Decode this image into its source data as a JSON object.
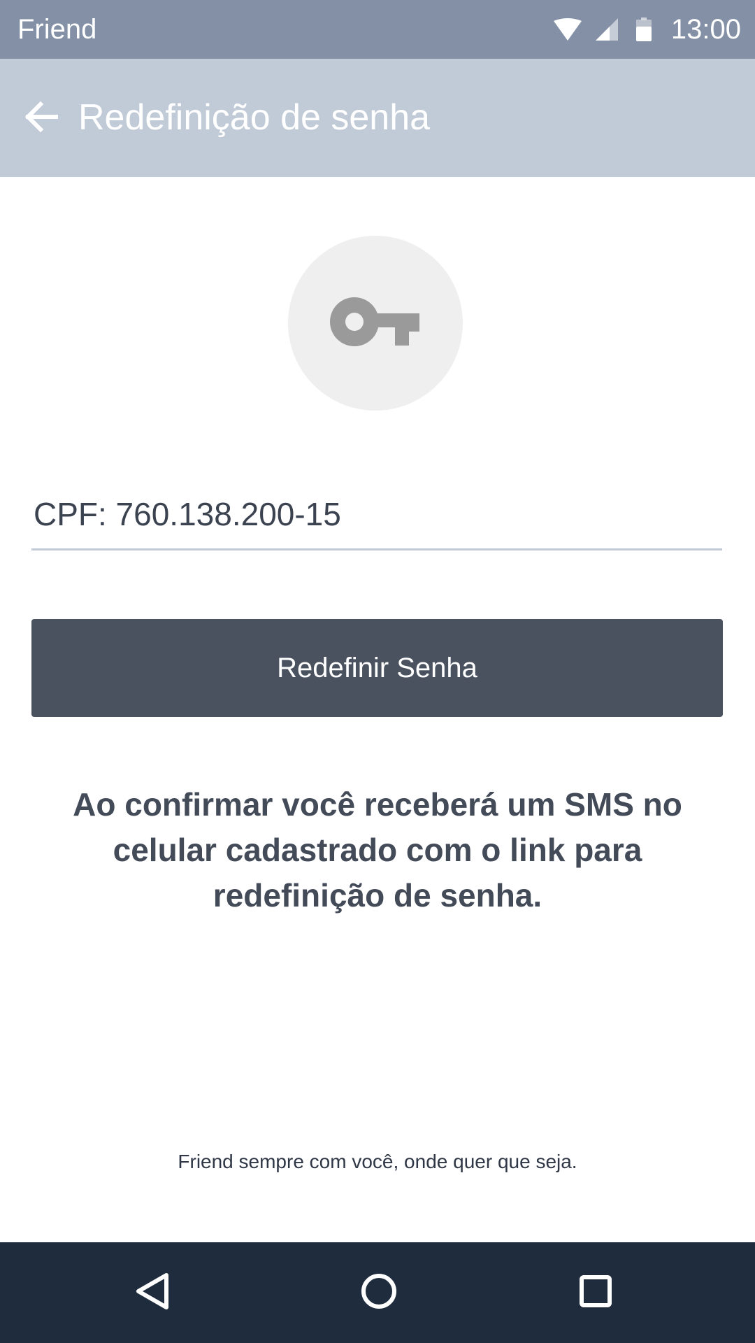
{
  "status_bar": {
    "carrier": "Friend",
    "time": "13:00",
    "icons": [
      "wifi-icon",
      "cell-signal-icon",
      "battery-icon"
    ]
  },
  "app_bar": {
    "title": "Redefinição de senha",
    "back_icon": "arrow-back-icon"
  },
  "hero": {
    "icon": "key-icon"
  },
  "form": {
    "cpf_value": "CPF: 760.138.200-15"
  },
  "actions": {
    "reset_label": "Redefinir Senha"
  },
  "info": {
    "text": "Ao confirmar você receberá um SMS no celular cadastrado com o link para redefinição de senha."
  },
  "footer": {
    "text": "Friend sempre com você, onde quer que seja."
  },
  "nav_bar": {
    "icons": [
      "back-triangle-icon",
      "home-circle-icon",
      "recents-square-icon"
    ]
  },
  "colors": {
    "status_bar": "#8390a6",
    "app_bar": "#c1cbd8",
    "button": "#4a5260",
    "nav_bar": "#1f2c3d",
    "text_dark": "#434a58"
  }
}
